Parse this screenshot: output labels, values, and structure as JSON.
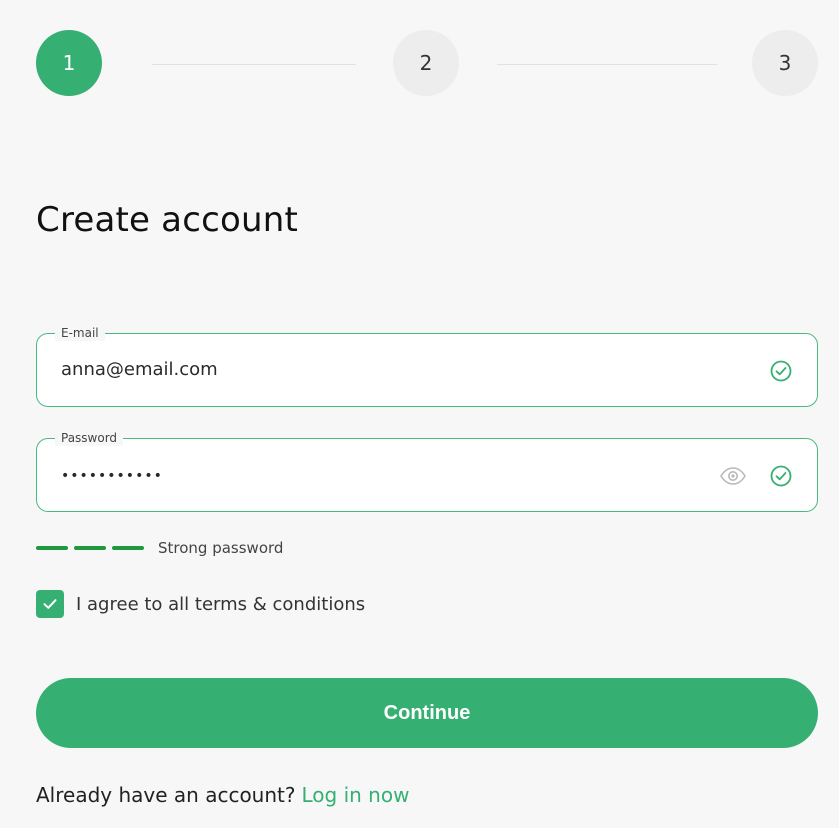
{
  "stepper": {
    "steps": [
      {
        "label": "1",
        "state": "active"
      },
      {
        "label": "2",
        "state": "inactive"
      },
      {
        "label": "3",
        "state": "inactive"
      }
    ]
  },
  "form": {
    "title": "Create account",
    "email": {
      "label": "E-mail",
      "value": "anna@email.com",
      "valid_icon": "check-circle-icon"
    },
    "password": {
      "label": "Password",
      "value": "•••••••••••",
      "show_icon": "eye-icon",
      "valid_icon": "check-circle-icon"
    },
    "strength": {
      "text": "Strong password",
      "level": 3,
      "max": 3
    },
    "terms": {
      "checked": true,
      "text": "I agree to all terms & conditions"
    },
    "continue_label": "Continue",
    "login_prompt": "Already have an account?",
    "login_link": "Log in now"
  },
  "colors": {
    "accent": "#35b072",
    "strength_bar": "#1e9a3c",
    "field_border": "#49b982"
  }
}
